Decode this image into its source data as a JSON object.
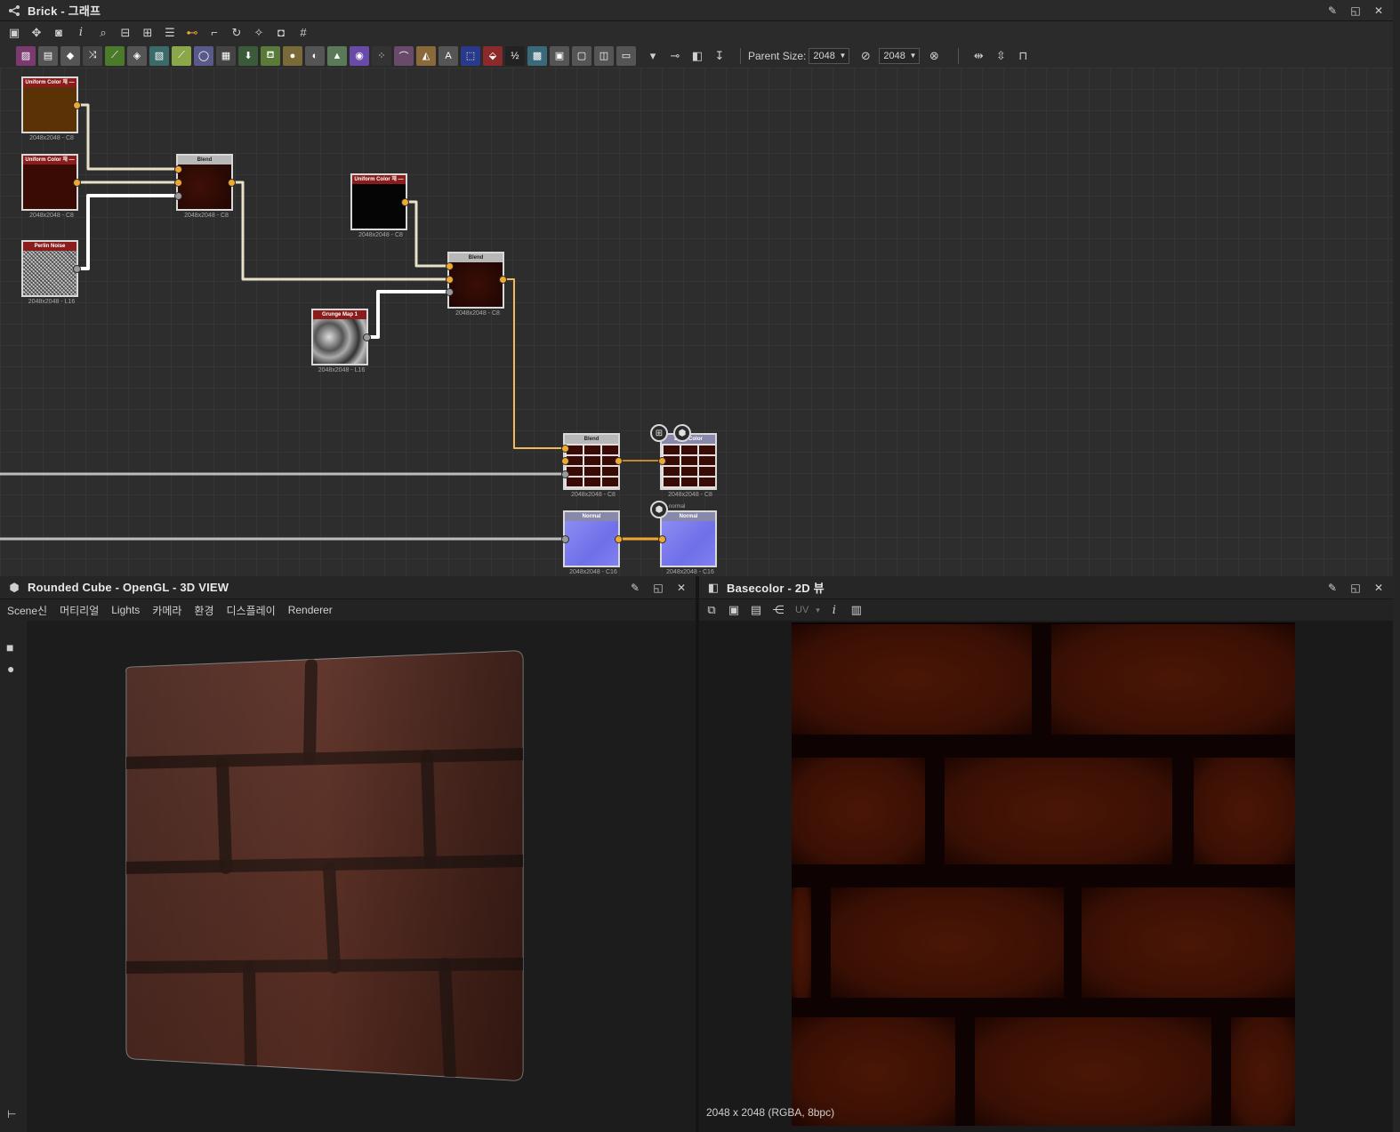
{
  "graph_window": {
    "title": "Brick - 그래프",
    "icon": "graph-icon"
  },
  "toolbar": {
    "parent_size_label": "Parent Size:",
    "parent_size_value": "2048",
    "size_value_2": "2048"
  },
  "nodes": {
    "n1": {
      "header": "Uniform Color 채 —",
      "footer": "2048x2048 - C8"
    },
    "n2": {
      "header": "Uniform Color 채 —",
      "footer": "2048x2048 - C8"
    },
    "n3": {
      "header": "Perlin Noise",
      "footer": "2048x2048 - L16"
    },
    "n4": {
      "header": "Blend",
      "footer": "2048x2048 - C8"
    },
    "n5": {
      "header": "Uniform Color 채 —",
      "footer": "2048x2048 - C8"
    },
    "n6": {
      "header": "Grunge Map 1",
      "footer": "2048x2048 - L16"
    },
    "n7": {
      "header": "Blend",
      "footer": "2048x2048 - C8"
    },
    "n8": {
      "header": "Blend",
      "footer": "2048x2048 - C8"
    },
    "n9": {
      "header": "Base Color",
      "footer": "2048x2048 - C8"
    },
    "n10": {
      "header": "Normal",
      "footer": "2048x2048 - C16"
    },
    "n11": {
      "header": "Normal",
      "footer": "2048x2048 - C16",
      "tag": "normal"
    }
  },
  "view3d": {
    "title": "Rounded Cube - OpenGL - 3D VIEW",
    "icon": "cube-icon",
    "menu": [
      "Scene신",
      "머티리얼",
      "Lights",
      "카메라",
      "환경",
      "디스플레이",
      "Renderer"
    ]
  },
  "view2d": {
    "title": "Basecolor - 2D 뷰",
    "icon": "image-icon",
    "uv_label": "UV",
    "status": "2048 x 2048 (RGBA, 8bpc)"
  },
  "colors": {
    "accent": "#f0a830",
    "node_dark_red": "#3a0a04",
    "node_brown": "#5a3206",
    "normal_blue": "#7b7bf0"
  }
}
